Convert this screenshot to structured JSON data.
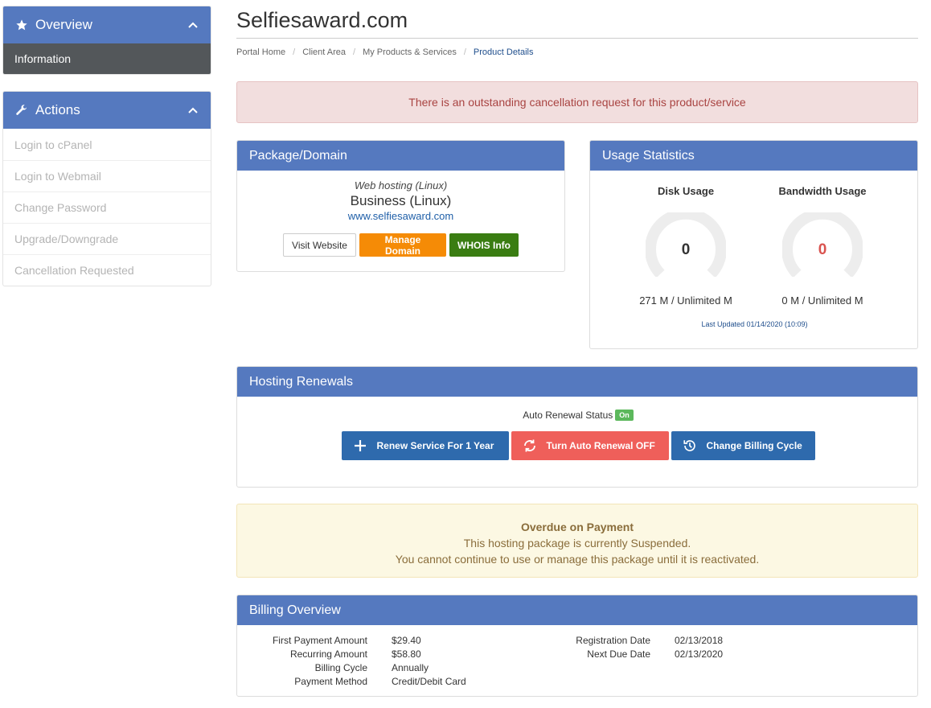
{
  "sidebar": {
    "overview": {
      "title": "Overview",
      "icon": "star-icon",
      "items": [
        "Information"
      ]
    },
    "actions": {
      "title": "Actions",
      "icon": "wrench-icon",
      "items": [
        "Login to cPanel",
        "Login to Webmail",
        "Change Password",
        "Upgrade/Downgrade",
        "Cancellation Requested"
      ]
    }
  },
  "page": {
    "title": "Selfiesaward.com"
  },
  "breadcrumb": [
    "Portal Home",
    "Client Area",
    "My Products & Services",
    "Product Details"
  ],
  "cancel_alert": "There is an outstanding cancellation request for this product/service",
  "package": {
    "heading": "Package/Domain",
    "type": "Web hosting (Linux)",
    "name": "Business (Linux)",
    "domain": "www.selfiesaward.com",
    "buttons": {
      "visit": "Visit Website",
      "manage": "Manage Domain",
      "whois": "WHOIS Info"
    }
  },
  "usage": {
    "heading": "Usage Statistics",
    "disk": {
      "label": "Disk Usage",
      "value": "0",
      "detail": "271 M / Unlimited M"
    },
    "bandwidth": {
      "label": "Bandwidth Usage",
      "value": "0",
      "detail": "0 M / Unlimited M"
    },
    "last_updated": "Last Updated 01/14/2020 (10:09)"
  },
  "renewals": {
    "heading": "Hosting Renewals",
    "status_label": "Auto Renewal Status",
    "status_badge": "On",
    "buttons": {
      "renew": "Renew Service For 1 Year",
      "auto_off": "Turn Auto Renewal OFF",
      "cycle": "Change Billing Cycle"
    }
  },
  "overdue": {
    "title": "Overdue on Payment",
    "line1": "This hosting package is currently Suspended.",
    "line2": "You cannot continue to use or manage this package until it is reactivated."
  },
  "billing": {
    "heading": "Billing Overview",
    "first_payment_label": "First Payment Amount",
    "first_payment": "$29.40",
    "recurring_label": "Recurring Amount",
    "recurring": "$58.80",
    "cycle_label": "Billing Cycle",
    "cycle": "Annually",
    "method_label": "Payment Method",
    "method": "Credit/Debit Card",
    "registration_label": "Registration Date",
    "registration": "02/13/2018",
    "next_due_label": "Next Due Date",
    "next_due": "02/13/2020"
  },
  "colors": {
    "primary": "#5579bf",
    "danger": "#d9534f",
    "orange": "#f58b06",
    "green": "#3a7d12"
  }
}
